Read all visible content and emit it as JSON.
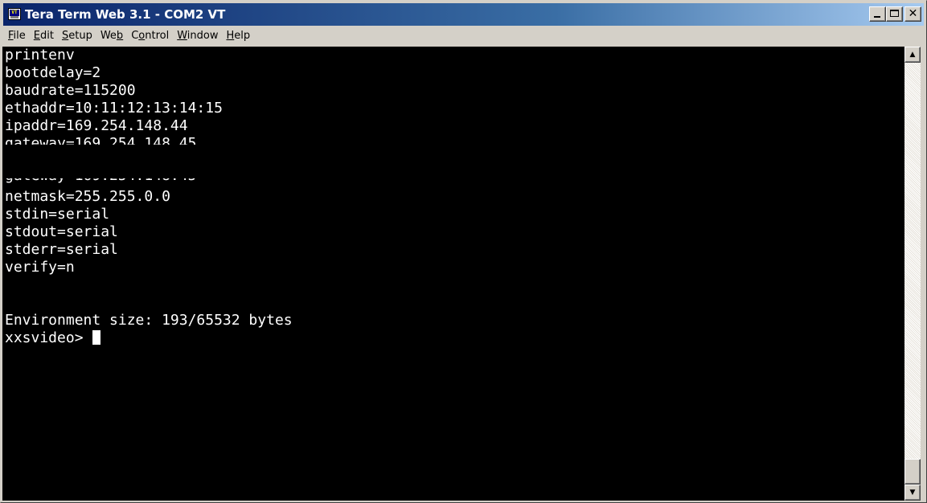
{
  "window": {
    "title": "Tera Term Web 3.1 - COM2 VT",
    "icon": "teraterm-app-icon",
    "icon_text": "VT",
    "controls": {
      "minimize_icon": "minimize-icon",
      "maximize_icon": "maximize-icon",
      "close_icon": "close-icon",
      "close_glyph": "✕"
    }
  },
  "menubar": {
    "items": [
      {
        "pre": "",
        "key": "F",
        "post": "ile"
      },
      {
        "pre": "",
        "key": "E",
        "post": "dit"
      },
      {
        "pre": "",
        "key": "S",
        "post": "etup"
      },
      {
        "pre": "We",
        "key": "b",
        "post": ""
      },
      {
        "pre": "C",
        "key": "o",
        "post": "ntrol"
      },
      {
        "pre": "",
        "key": "W",
        "post": "indow"
      },
      {
        "pre": "",
        "key": "H",
        "post": "elp"
      }
    ]
  },
  "terminal": {
    "lines": [
      "printenv",
      "bootdelay=2",
      "baudrate=115200",
      "ethaddr=10:11:12:13:14:15",
      "ipaddr=169.254.148.44",
      "gateway=169.254.148.45",
      "netmask=255.255.0.0",
      "stdin=serial",
      "stdout=serial",
      "stderr=serial",
      "verify=n",
      "",
      "Environment size: 193/65532 bytes"
    ],
    "prompt": "xxsvideo> ",
    "colors": {
      "background": "#000000",
      "foreground": "#ffffff"
    }
  },
  "scrollbar": {
    "up_icon": "scroll-up-arrow-icon",
    "down_icon": "scroll-down-arrow-icon",
    "up_glyph": "▲",
    "down_glyph": "▼"
  }
}
